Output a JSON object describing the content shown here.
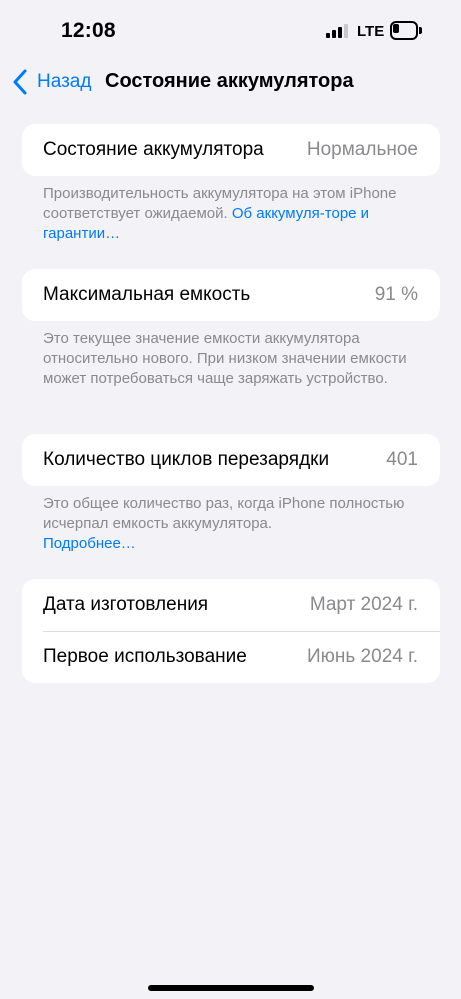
{
  "status_bar": {
    "time": "12:08",
    "network": "LTE",
    "signal_bars_active": 3,
    "signal_bars_total": 4,
    "battery_level_percent": 25
  },
  "nav": {
    "back_label": "Назад",
    "title": "Состояние аккумулятора"
  },
  "battery_health": {
    "label": "Состояние аккумулятора",
    "value": "Нормальное",
    "footnote_text": "Производительность аккумулятора на этом iPhone соответствует ожидаемой. ",
    "footnote_link": "Об аккумуля-торе и гарантии…"
  },
  "max_capacity": {
    "label": "Максимальная емкость",
    "value": "91 %",
    "footnote_text": "Это текущее значение емкости аккумулятора относительно нового. При низком значении емкости может потребоваться чаще заряжать устройство."
  },
  "cycle_count": {
    "label": "Количество циклов перезарядки",
    "value": "401",
    "footnote_text": "Это общее количество раз, когда iPhone полностью исчерпал емкость аккумулятора.",
    "footnote_link": "Подробнее…"
  },
  "dates": {
    "manufacture_label": "Дата изготовления",
    "manufacture_value": "Март 2024 г.",
    "first_use_label": "Первое использование",
    "first_use_value": "Июнь 2024 г."
  },
  "colors": {
    "accent": "#007aff",
    "background": "#f2f2f7",
    "secondary_text": "#8a8a8e"
  }
}
